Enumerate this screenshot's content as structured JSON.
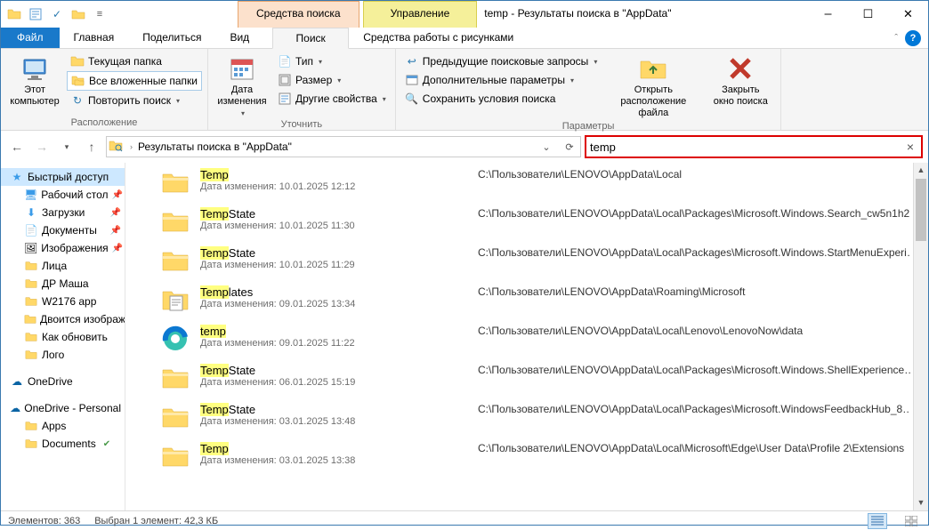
{
  "title": "temp - Результаты поиска в \"AppData\"",
  "context_tabs": {
    "search": "Средства поиска",
    "manage": "Управление"
  },
  "menu": {
    "file": "Файл",
    "home": "Главная",
    "share": "Поделиться",
    "view": "Вид",
    "search": "Поиск",
    "pictools": "Средства работы с рисунками"
  },
  "ribbon": {
    "group_location": "Расположение",
    "this_pc": "Этот\nкомпьютер",
    "current_folder": "Текущая папка",
    "all_subfolders": "Все вложенные папки",
    "repeat_search": "Повторить поиск",
    "group_refine": "Уточнить",
    "date_modified": "Дата\nизменения",
    "type": "Тип",
    "size": "Размер",
    "other_props": "Другие свойства",
    "group_params": "Параметры",
    "prev_queries": "Предыдущие поисковые запросы",
    "adv_params": "Дополнительные параметры",
    "save_conditions": "Сохранить условия поиска",
    "open_location": "Открыть\nрасположение файла",
    "close_search": "Закрыть\nокно поиска"
  },
  "address": "Результаты поиска в \"AppData\"",
  "search_value": "temp",
  "tree": {
    "quick": "Быстрый доступ",
    "desktop": "Рабочий стол",
    "downloads": "Загрузки",
    "documents": "Документы",
    "pictures": "Изображения",
    "faces": "Лица",
    "dr": "ДР Маша",
    "w2176": "W2176 app",
    "dvoitsya": "Двоится изображение",
    "howto": "Как обновить",
    "logo": "Лого",
    "onedrive": "OneDrive",
    "onedrive_p": "OneDrive - Personal",
    "apps": "Apps",
    "documents2": "Documents"
  },
  "results": [
    {
      "name_pre": "",
      "name_hl": "Temp",
      "name_post": "",
      "meta_label": "Дата изменения:",
      "meta_val": "10.01.2025 12:12",
      "path": "C:\\Пользователи\\LENOVO\\AppData\\Local",
      "icon": "folder"
    },
    {
      "name_pre": "",
      "name_hl": "Temp",
      "name_post": "State",
      "meta_label": "Дата изменения:",
      "meta_val": "10.01.2025 11:30",
      "path": "C:\\Пользователи\\LENOVO\\AppData\\Local\\Packages\\Microsoft.Windows.Search_cw5n1h2…",
      "icon": "folder"
    },
    {
      "name_pre": "",
      "name_hl": "Temp",
      "name_post": "State",
      "meta_label": "Дата изменения:",
      "meta_val": "10.01.2025 11:29",
      "path": "C:\\Пользователи\\LENOVO\\AppData\\Local\\Packages\\Microsoft.Windows.StartMenuExperi…",
      "icon": "folder"
    },
    {
      "name_pre": "",
      "name_hl": "Temp",
      "name_post": "lates",
      "meta_label": "Дата изменения:",
      "meta_val": "09.01.2025 13:34",
      "path": "C:\\Пользователи\\LENOVO\\AppData\\Roaming\\Microsoft",
      "icon": "folder-doc"
    },
    {
      "name_pre": "",
      "name_hl": "temp",
      "name_post": "",
      "meta_label": "Дата изменения:",
      "meta_val": "09.01.2025 11:22",
      "path": "C:\\Пользователи\\LENOVO\\AppData\\Local\\Lenovo\\LenovoNow\\data",
      "icon": "edge"
    },
    {
      "name_pre": "",
      "name_hl": "Temp",
      "name_post": "State",
      "meta_label": "Дата изменения:",
      "meta_val": "06.01.2025 15:19",
      "path": "C:\\Пользователи\\LENOVO\\AppData\\Local\\Packages\\Microsoft.Windows.ShellExperience…",
      "icon": "folder"
    },
    {
      "name_pre": "",
      "name_hl": "Temp",
      "name_post": "State",
      "meta_label": "Дата изменения:",
      "meta_val": "03.01.2025 13:48",
      "path": "C:\\Пользователи\\LENOVO\\AppData\\Local\\Packages\\Microsoft.WindowsFeedbackHub_8…",
      "icon": "folder"
    },
    {
      "name_pre": "",
      "name_hl": "Temp",
      "name_post": "",
      "meta_label": "Дата изменения:",
      "meta_val": "03.01.2025 13:38",
      "path": "C:\\Пользователи\\LENOVO\\AppData\\Local\\Microsoft\\Edge\\User Data\\Profile 2\\Extensions",
      "icon": "folder"
    }
  ],
  "status": {
    "count_label": "Элементов:",
    "count": "363",
    "selection": "Выбран 1 элемент: 42,3 КБ"
  }
}
